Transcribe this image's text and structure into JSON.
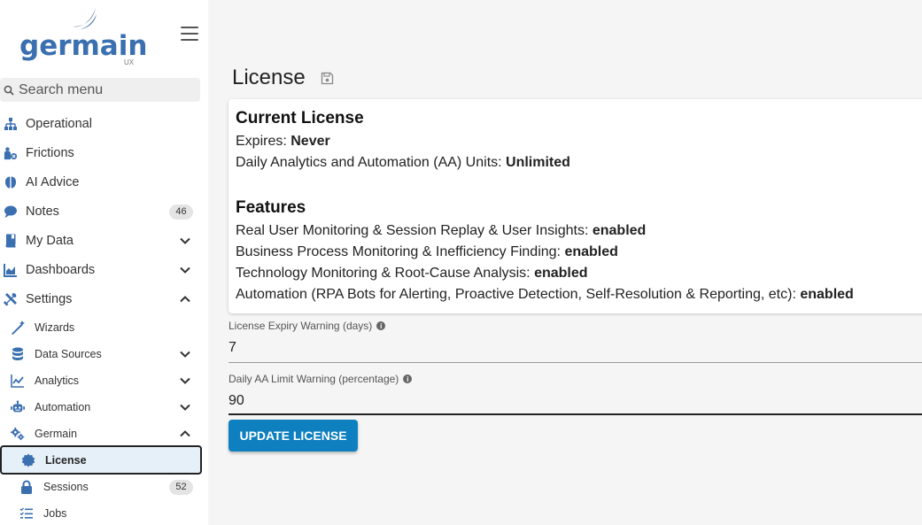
{
  "brand": {
    "name": "germain",
    "sub": "UX",
    "color": "#3a6fb0"
  },
  "search": {
    "placeholder": "Search menu"
  },
  "sidebar": {
    "items": [
      {
        "label": "Operational",
        "icon": "sitemap-icon"
      },
      {
        "label": "Frictions",
        "icon": "person-error-icon"
      },
      {
        "label": "AI Advice",
        "icon": "brain-icon"
      },
      {
        "label": "Notes",
        "icon": "comment-icon",
        "badge": "46"
      },
      {
        "label": "My Data",
        "icon": "book-icon"
      },
      {
        "label": "Dashboards",
        "icon": "area-chart-icon"
      },
      {
        "label": "Settings",
        "icon": "tools-icon"
      }
    ],
    "settings_items": [
      {
        "label": "Wizards",
        "icon": "wand-icon"
      },
      {
        "label": "Data Sources",
        "icon": "database-icon"
      },
      {
        "label": "Analytics",
        "icon": "line-chart-icon"
      },
      {
        "label": "Automation",
        "icon": "robot-icon"
      },
      {
        "label": "Germain",
        "icon": "cogs-icon"
      }
    ],
    "germain_items": [
      {
        "label": "License",
        "icon": "certificate-icon"
      },
      {
        "label": "Sessions",
        "icon": "lock-icon",
        "badge": "52"
      },
      {
        "label": "Jobs",
        "icon": "tasks-icon"
      }
    ]
  },
  "main": {
    "title": "License",
    "current_license": {
      "heading": "Current License",
      "expires_label": "Expires: ",
      "expires_value": "Never",
      "units_label": "Daily Analytics and Automation (AA) Units: ",
      "units_value": "Unlimited"
    },
    "features": {
      "heading": "Features",
      "items": [
        {
          "label": "Real User Monitoring & Session Replay & User Insights: ",
          "value": "enabled"
        },
        {
          "label": "Business Process Monitoring & Inefficiency Finding: ",
          "value": "enabled"
        },
        {
          "label": "Technology Monitoring & Root-Cause Analysis: ",
          "value": "enabled"
        },
        {
          "label": "Automation (RPA Bots for Alerting, Proactive Detection, Self-Resolution & Reporting, etc): ",
          "value": "enabled"
        }
      ]
    },
    "expiry_warning": {
      "label": "License Expiry Warning (days)",
      "value": "7"
    },
    "aa_warning": {
      "label": "Daily AA Limit Warning (percentage)",
      "value": "90"
    },
    "update_button": "UPDATE LICENSE"
  },
  "colors": {
    "accent": "#0e7fbf",
    "icon": "#3a6fb0",
    "active_bg": "#e6f0f9"
  }
}
